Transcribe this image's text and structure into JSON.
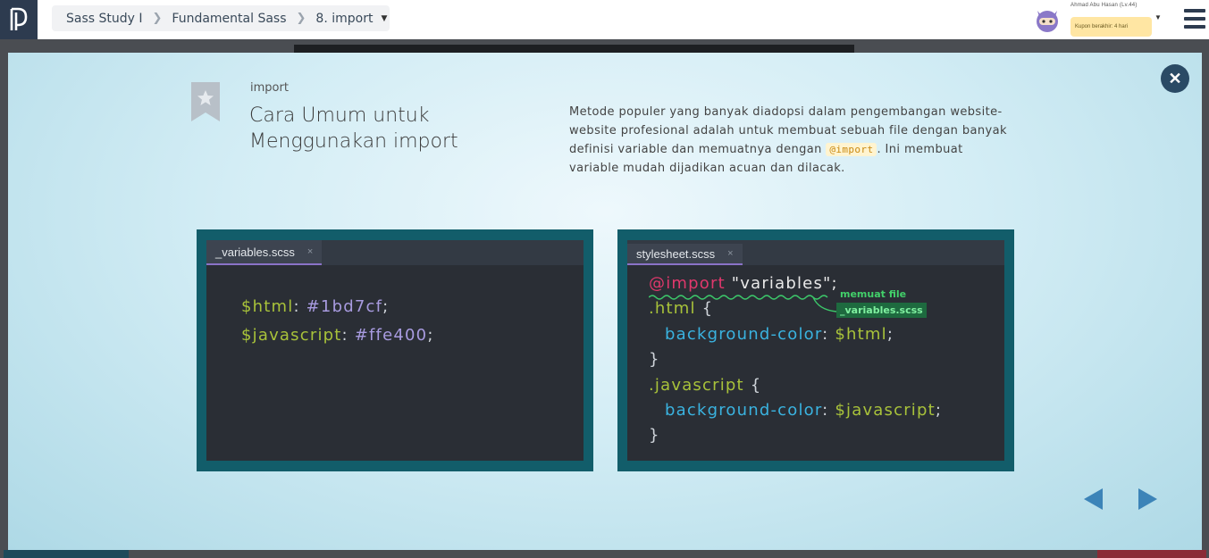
{
  "breadcrumb": {
    "items": [
      "Sass Study I",
      "Fundamental Sass",
      "8. import"
    ]
  },
  "user": {
    "name": "Ahmad Abu Hasan (Lv.44)",
    "coupon": "Kupon berakhir: 4 hari"
  },
  "slide": {
    "subtitle": "import",
    "title": "Cara Umum untuk Menggunakan import",
    "description_before": "Metode populer yang banyak diadopsi dalam pengembangan website-website profesional adalah untuk membuat sebuah file dengan banyak definisi variable dan memuatnya dengan ",
    "description_code": "@import",
    "description_after": ". Ini membuat variable mudah dijadikan acuan dan dilacak."
  },
  "left_editor": {
    "tab": "_variables.scss",
    "tab_close": "×",
    "lines": [
      {
        "name": "$html",
        "sep": ": ",
        "value": "#1bd7cf",
        "end": ";"
      },
      {
        "name": "$javascript",
        "sep": ": ",
        "value": "#ffe400",
        "end": ";"
      }
    ]
  },
  "right_editor": {
    "tab": "stylesheet.scss",
    "tab_close": "×",
    "import_kw": "@import",
    "import_str": "\"variables\";",
    "sel1": ".html",
    "sel2": ".javascript",
    "open_brace": " {",
    "close_brace": "}",
    "prop": "background-color",
    "colon": ": ",
    "val1": "$html",
    "val2": "$javascript",
    "semi": ";",
    "note_line1": "memuat file",
    "note_line2": "_variables.scss"
  },
  "colors": {
    "accent": "#3c84b8",
    "panel": "#125d6a",
    "editor_bg": "#2a2e35"
  }
}
